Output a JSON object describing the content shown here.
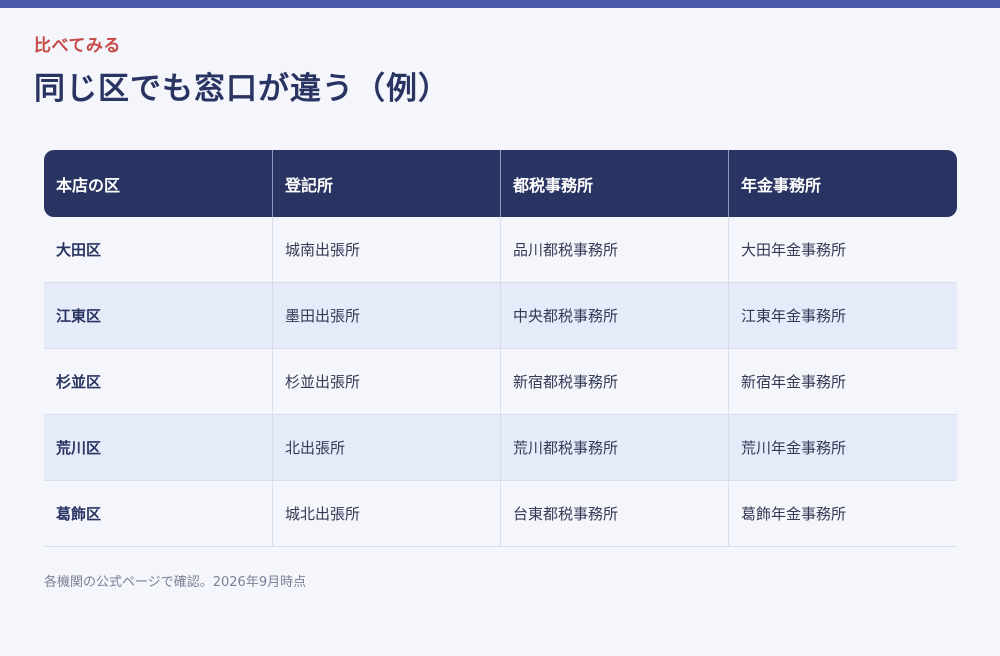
{
  "header": {
    "eyebrow": "比べてみる",
    "title": "同じ区でも窓口が違う（例）"
  },
  "table": {
    "columns": [
      "本店の区",
      "登記所",
      "都税事務所",
      "年金事務所"
    ],
    "rows": [
      [
        "大田区",
        "城南出張所",
        "品川都税事務所",
        "大田年金事務所"
      ],
      [
        "江東区",
        "墨田出張所",
        "中央都税事務所",
        "江東年金事務所"
      ],
      [
        "杉並区",
        "杉並出張所",
        "新宿都税事務所",
        "新宿年金事務所"
      ],
      [
        "荒川区",
        "北出張所",
        "荒川都税事務所",
        "荒川年金事務所"
      ],
      [
        "葛飾区",
        "城北出張所",
        "台東都税事務所",
        "葛飾年金事務所"
      ]
    ]
  },
  "footnote": "各機関の公式ページで確認。2026年9月時点",
  "colors": {
    "accent_bar": "#4a5aa8",
    "eyebrow": "#c64a46",
    "header_bg": "#2a3463",
    "alt_row": "#e6ebf9"
  }
}
